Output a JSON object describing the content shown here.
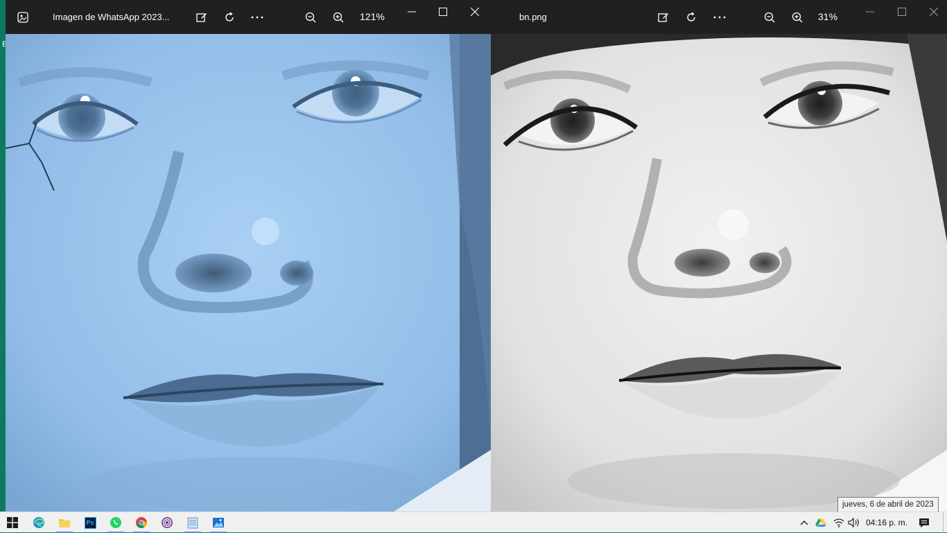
{
  "desktop": {
    "letter": "E"
  },
  "left_window": {
    "title": "Imagen de WhatsApp 2023...",
    "zoom": "121%",
    "icons": [
      "photos-app-icon",
      "edit-image-icon",
      "rotate-icon",
      "more-icon",
      "zoom-out-icon",
      "zoom-in-icon",
      "minimize-icon",
      "maximize-icon",
      "close-icon"
    ],
    "photo_tint": "#9ec4ea"
  },
  "right_window": {
    "title": "bn.png",
    "zoom": "31%",
    "icons": [
      "edit-image-icon",
      "rotate-icon",
      "more-icon",
      "zoom-out-icon",
      "zoom-in-icon",
      "minimize-icon",
      "maximize-icon",
      "close-icon"
    ],
    "photo_tint": "#e6e6e6"
  },
  "tooltip": {
    "text": "jueves, 6 de abril de 2023"
  },
  "taskbar": {
    "apps": [
      {
        "name": "windows-start-icon"
      },
      {
        "name": "edge-icon"
      },
      {
        "name": "file-explorer-icon"
      },
      {
        "name": "photoshop-icon",
        "label": "Ps"
      },
      {
        "name": "whatsapp-icon"
      },
      {
        "name": "chrome-icon"
      },
      {
        "name": "tor-browser-icon"
      },
      {
        "name": "notepad-icon"
      },
      {
        "name": "photos-icon"
      }
    ],
    "tray": [
      "show-hidden-icons-chevron",
      "google-drive-icon",
      "wifi-icon",
      "volume-icon",
      "notifications-icon"
    ],
    "clock": "04:16 p. m."
  },
  "colors": {
    "titlebar": "#202020",
    "desktop": "#0d7a5f",
    "taskbar": "#f0f0f0",
    "accent": "#4a90d9"
  }
}
